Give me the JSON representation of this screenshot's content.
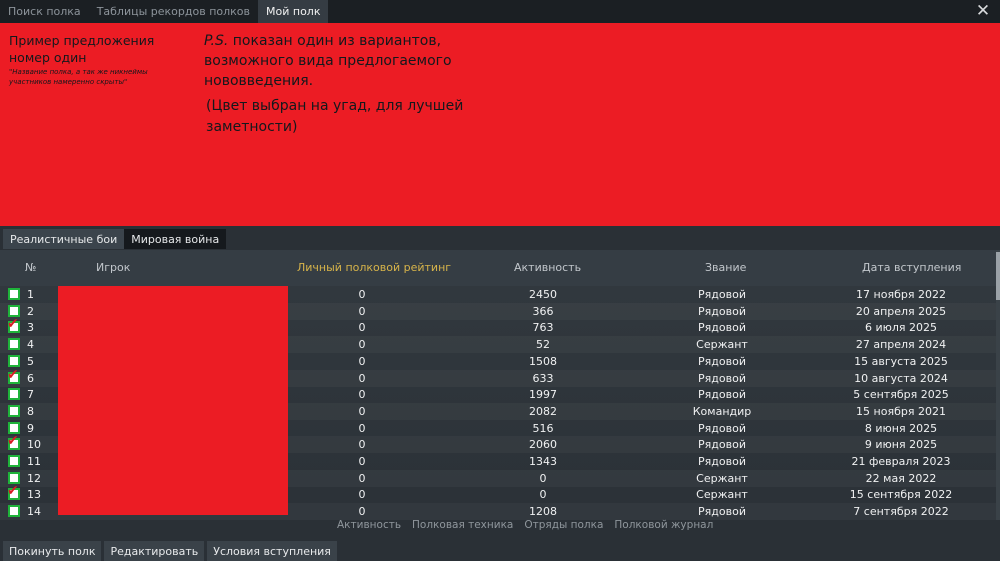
{
  "top_tabs": [
    "Поиск полка",
    "Таблицы рекордов полков",
    "Мой полк"
  ],
  "close_symbol": "✕",
  "proposal": {
    "title": "Пример предложения номер один",
    "note": "\"Название полка, а так же никнеймы участников намеренно скрыты\"",
    "ps_label": "P.S.",
    "ps_text": "показан один из вариантов, возможного вида предлогаемого нововведения.",
    "color_note": "(Цвет выбран на угад, для лучшей заметности)"
  },
  "mode_tabs": [
    "Реалистичные бои",
    "Мировая война"
  ],
  "columns": {
    "num": "№",
    "player": "Игрок",
    "rating": "Личный полковой рейтинг",
    "activity": "Активность",
    "rank": "Звание",
    "joined": "Дата вступления"
  },
  "rows": [
    {
      "num": "1",
      "checked": false,
      "rating": "0",
      "activity": "2450",
      "rank": "Рядовой",
      "joined": "17 ноября 2022"
    },
    {
      "num": "2",
      "checked": false,
      "rating": "0",
      "activity": "366",
      "rank": "Рядовой",
      "joined": "20 апреля 2025"
    },
    {
      "num": "3",
      "checked": true,
      "rating": "0",
      "activity": "763",
      "rank": "Рядовой",
      "joined": "6 июля 2025"
    },
    {
      "num": "4",
      "checked": false,
      "rating": "0",
      "activity": "52",
      "rank": "Сержант",
      "joined": "27 апреля 2024"
    },
    {
      "num": "5",
      "checked": false,
      "rating": "0",
      "activity": "1508",
      "rank": "Рядовой",
      "joined": "15 августа 2025"
    },
    {
      "num": "6",
      "checked": true,
      "rating": "0",
      "activity": "633",
      "rank": "Рядовой",
      "joined": "10 августа 2024"
    },
    {
      "num": "7",
      "checked": false,
      "rating": "0",
      "activity": "1997",
      "rank": "Рядовой",
      "joined": "5 сентября 2025"
    },
    {
      "num": "8",
      "checked": false,
      "rating": "0",
      "activity": "2082",
      "rank": "Командир",
      "joined": "15 ноября 2021"
    },
    {
      "num": "9",
      "checked": false,
      "rating": "0",
      "activity": "516",
      "rank": "Рядовой",
      "joined": "8 июня 2025"
    },
    {
      "num": "10",
      "checked": true,
      "rating": "0",
      "activity": "2060",
      "rank": "Рядовой",
      "joined": "9 июня 2025"
    },
    {
      "num": "11",
      "checked": false,
      "rating": "0",
      "activity": "1343",
      "rank": "Рядовой",
      "joined": "21 февраля 2023"
    },
    {
      "num": "12",
      "checked": false,
      "rating": "0",
      "activity": "0",
      "rank": "Сержант",
      "joined": "22 мая 2022"
    },
    {
      "num": "13",
      "checked": true,
      "rating": "0",
      "activity": "0",
      "rank": "Сержант",
      "joined": "15 сентября 2022"
    },
    {
      "num": "14",
      "checked": false,
      "rating": "0",
      "activity": "1208",
      "rank": "Рядовой",
      "joined": "7 сентября 2022"
    }
  ],
  "bottom_links": [
    "Активность",
    "Полковая техника",
    "Отряды полка",
    "Полковой журнал"
  ],
  "actions": [
    "Покинуть полк",
    "Редактировать",
    "Условия вступления"
  ],
  "colors": {
    "redact": "#ec1c24",
    "checkbox_border": "#1fb33a",
    "checkmark": "#d81c24",
    "rating_header": "#d7b44a"
  }
}
